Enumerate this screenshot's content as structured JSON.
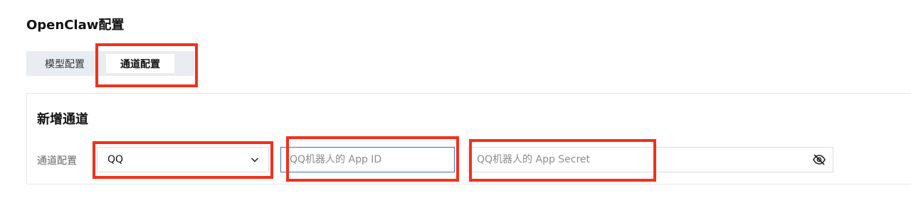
{
  "page": {
    "title": "OpenClaw配置"
  },
  "tabs": [
    {
      "label": "模型配置",
      "active": false
    },
    {
      "label": "通道配置",
      "active": true
    }
  ],
  "section": {
    "title": "新增通道"
  },
  "channel": {
    "label": "通道配置",
    "select_value": "QQ",
    "app_id_placeholder": "QQ机器人的 App ID",
    "app_secret_placeholder": "QQ机器人的 App Secret",
    "secret_icon": "eye-off-icon"
  },
  "colors": {
    "highlight": "#f2311b",
    "focus_border": "#2f6fe4",
    "tab_bg": "#e9ecf1"
  }
}
